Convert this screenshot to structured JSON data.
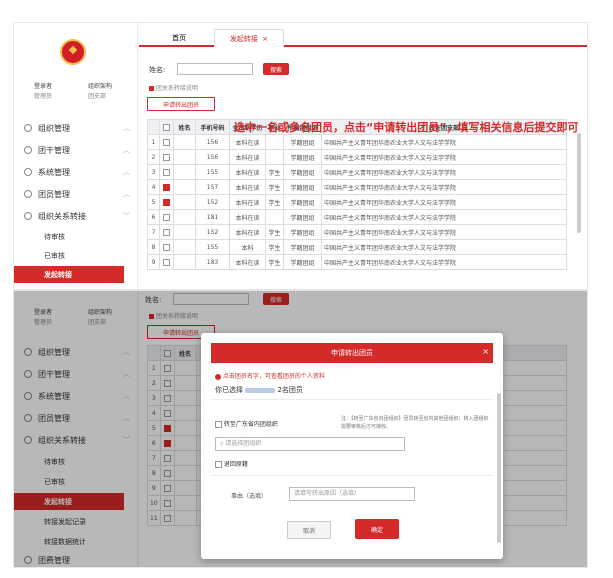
{
  "sidebar": {
    "user1": "登录者",
    "role1": "管理员",
    "user2": "组织架构",
    "role2": "团支部",
    "items": [
      {
        "label": "组织管理",
        "icon": "org-icon"
      },
      {
        "label": "团干管理",
        "icon": "cadre-icon"
      },
      {
        "label": "系统管理",
        "icon": "settings-icon"
      },
      {
        "label": "团员管理",
        "icon": "member-icon"
      },
      {
        "label": "组织关系转接",
        "icon": "transfer-icon"
      }
    ],
    "sub_items": [
      "待审核",
      "已审核",
      "发起转接"
    ],
    "sub_items_extra": [
      "转接发起记录",
      "转接数据统计"
    ],
    "last_item": "团费管理"
  },
  "tabs": {
    "home": "首页",
    "current": "发起转接",
    "close": "×"
  },
  "search": {
    "label": "姓名:",
    "placeholder": "",
    "button": "搜索"
  },
  "notice": "团关系转接说明",
  "apply_button": "申请转出团员",
  "instruction": "选中一名或多名团员，点击“申请转出团员”，填写相关信息后提交即可",
  "table": {
    "headers": [
      "",
      "",
      "姓名",
      "手机号码",
      "全日制学历",
      "职业",
      "所属团组织",
      "所在团支部"
    ],
    "rows": [
      {
        "no": "1",
        "checked": false,
        "name": "",
        "phone": "156",
        "edu": "本科在读",
        "job": "",
        "status": "学籍团组",
        "branch": "中国共产主义青年团华南农业大学人文与法学学院"
      },
      {
        "no": "2",
        "checked": false,
        "name": "",
        "phone": "156",
        "edu": "本科在读",
        "job": "",
        "status": "学籍团组",
        "branch": "中国共产主义青年团华南农业大学人文与法学学院"
      },
      {
        "no": "3",
        "checked": false,
        "name": "",
        "phone": "155",
        "edu": "本科在读",
        "job": "学生",
        "status": "学籍团组",
        "branch": "中国共产主义青年团华南农业大学人文与法学学院"
      },
      {
        "no": "4",
        "checked": true,
        "name": "",
        "phone": "157",
        "edu": "本科在读",
        "job": "学生",
        "status": "学籍团组",
        "branch": "中国共产主义青年团华南农业大学人文与法学学院"
      },
      {
        "no": "5",
        "checked": true,
        "name": "",
        "phone": "152",
        "edu": "本科在读",
        "job": "学生",
        "status": "学籍团组",
        "branch": "中国共产主义青年团华南农业大学人文与法学学院"
      },
      {
        "no": "6",
        "checked": false,
        "name": "",
        "phone": "181",
        "edu": "本科在读",
        "job": "",
        "status": "学籍团组",
        "branch": "中国共产主义青年团华南农业大学人文与法学学院"
      },
      {
        "no": "7",
        "checked": false,
        "name": "",
        "phone": "152",
        "edu": "本科在读",
        "job": "学生",
        "status": "学籍团组",
        "branch": "中国共产主义青年团华南农业大学人文与法学学院"
      },
      {
        "no": "8",
        "checked": false,
        "name": "",
        "phone": "155",
        "edu": "本科",
        "job": "学生",
        "status": "学籍团组",
        "branch": "中国共产主义青年团华南农业大学人文与法学学院"
      },
      {
        "no": "9",
        "checked": false,
        "name": "",
        "phone": "183",
        "edu": "本科在读",
        "job": "学生",
        "status": "学籍团组",
        "branch": "中国共产主义青年团华南农业大学人文与法学学院"
      }
    ],
    "row_numbers_2": [
      "1",
      "2",
      "3",
      "4",
      "5",
      "6",
      "7",
      "8",
      "9",
      "10",
      "11"
    ],
    "row_checked_2": [
      false,
      false,
      false,
      false,
      true,
      true,
      false,
      false,
      false,
      false,
      false
    ]
  },
  "modal": {
    "title": "申请转出团员",
    "close": "×",
    "tip": "点击团员名字，可查看团员的个人资料",
    "selected_prefix": "你已选择",
    "selected_suffix": "名团员",
    "option1": "转至广东省内团组织",
    "option1_desc": "注：【转至广东省内团组织】团员转至省内其他团组织；转入团组织需要审核后才可接收。",
    "search_placeholder": "请选择团组织",
    "option2": "退回原籍",
    "reason_label": "事由（选填）",
    "reason_placeholder": "请填写转出原因（选填）",
    "cancel": "取消",
    "confirm": "确定"
  },
  "colors": {
    "accent": "#d42a2a"
  }
}
